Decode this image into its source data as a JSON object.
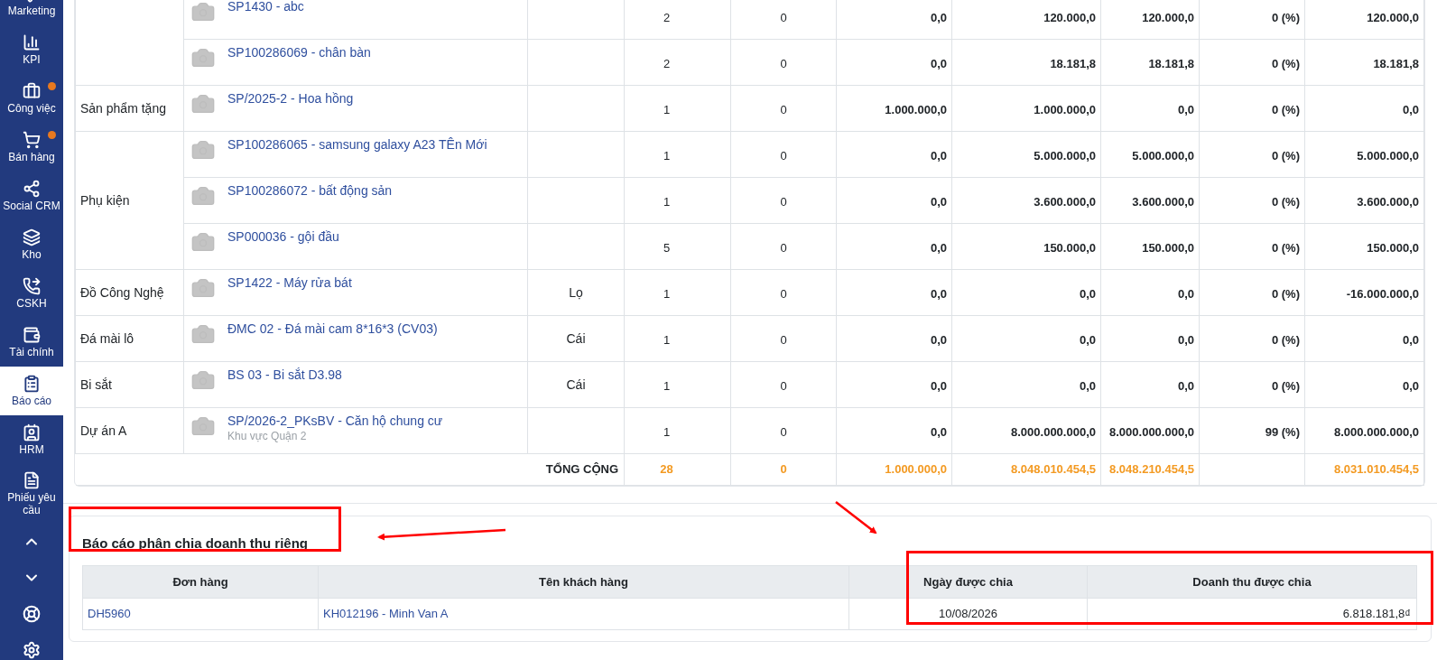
{
  "sidebar": {
    "items": [
      {
        "kind": "module",
        "label": "Marketing",
        "selected": false
      },
      {
        "kind": "module",
        "label": "KPI",
        "selected": false,
        "badge": false
      },
      {
        "kind": "module",
        "label": "Công việc",
        "selected": false,
        "badge": true
      },
      {
        "kind": "module",
        "label": "Bán hàng",
        "selected": false,
        "badge": true
      },
      {
        "kind": "module",
        "label": "Social CRM",
        "selected": false,
        "badge": false
      },
      {
        "kind": "module",
        "label": "Kho",
        "selected": false,
        "badge": false
      },
      {
        "kind": "module",
        "label": "CSKH",
        "selected": false,
        "badge": false
      },
      {
        "kind": "module",
        "label": "Tài chính",
        "selected": false,
        "badge": false
      },
      {
        "kind": "module",
        "label": "Báo cáo",
        "selected": true,
        "badge": false
      },
      {
        "kind": "module",
        "label": "HRM",
        "selected": false,
        "badge": false
      },
      {
        "kind": "module",
        "label": "Phiếu yêu cầu",
        "selected": false,
        "badge": false
      },
      {
        "kind": "icon",
        "selected": false
      },
      {
        "kind": "icon",
        "selected": false
      },
      {
        "kind": "icon",
        "selected": false
      },
      {
        "kind": "icon",
        "selected": false
      }
    ]
  },
  "sales_table": {
    "groups": [
      {
        "items": [
          {
            "product": "SP1430 - abc",
            "cells": [
              "2",
              "0",
              "0,0",
              "120.000,0",
              "120.000,0",
              "0 (%)",
              "120.000,0"
            ]
          },
          {
            "product": "SP100286069 - chân bàn",
            "cells": [
              "2",
              "0",
              "0,0",
              "18.181,8",
              "18.181,8",
              "0 (%)",
              "18.181,8"
            ]
          }
        ]
      },
      {
        "label": "Sản phẩm tặng",
        "items": [
          {
            "product": "SP/2025-2 - Hoa hồng",
            "cells": [
              "1",
              "0",
              "1.000.000,0",
              "1.000.000,0",
              "0,0",
              "0 (%)",
              "0,0"
            ]
          }
        ]
      },
      {
        "label": "Phụ kiện",
        "items": [
          {
            "product": "SP100286065 - samsung galaxy A23 TÊn Mới",
            "cells": [
              "1",
              "0",
              "0,0",
              "5.000.000,0",
              "5.000.000,0",
              "0 (%)",
              "5.000.000,0"
            ]
          },
          {
            "product": "SP100286072 - bất động sản",
            "cells": [
              "1",
              "0",
              "0,0",
              "3.600.000,0",
              "3.600.000,0",
              "0 (%)",
              "3.600.000,0"
            ]
          },
          {
            "product": "SP000036 - gội đầu",
            "cells": [
              "5",
              "0",
              "0,0",
              "150.000,0",
              "150.000,0",
              "0 (%)",
              "150.000,0"
            ]
          }
        ]
      },
      {
        "label": "Đồ Công Nghệ",
        "items": [
          {
            "product": "SP1422 - Máy rửa bát",
            "unit": "Lọ",
            "cells": [
              "1",
              "0",
              "0,0",
              "0,0",
              "0,0",
              "0 (%)",
              "-16.000.000,0"
            ]
          }
        ]
      },
      {
        "label": "Đá mài lô",
        "items": [
          {
            "product": "ĐMC 02 - Đá mài cam 8*16*3 (CV03)",
            "unit": "Cái",
            "cells": [
              "1",
              "0",
              "0,0",
              "0,0",
              "0,0",
              "0 (%)",
              "0,0"
            ]
          }
        ]
      },
      {
        "label": "Bi sắt",
        "items": [
          {
            "product": "BS 03 - Bi sắt D3.98",
            "unit": "Cái",
            "cells": [
              "1",
              "0",
              "0,0",
              "0,0",
              "0,0",
              "0 (%)",
              "0,0"
            ]
          }
        ]
      },
      {
        "label": "Dự án A",
        "items": [
          {
            "product": "SP/2026-2_PKsBV - Căn hộ chung cư",
            "subtitle": "Khu vực Quận 2",
            "cells": [
              "1",
              "0",
              "0,0",
              "8.000.000.000,0",
              "8.000.000.000,0",
              "99 (%)",
              "8.000.000.000,0"
            ]
          }
        ]
      }
    ],
    "total": {
      "label": "TỔNG CỘNG",
      "cells": [
        "28",
        "0",
        "1.000.000,0",
        "8.048.010.454,5",
        "8.048.210.454,5",
        null,
        "8.031.010.454,5"
      ]
    }
  },
  "split_report": {
    "title": "Báo cáo phân chia doanh thu riêng",
    "columns": [
      "Đơn hàng",
      "Tên khách hàng",
      "Ngày được chia",
      "Doanh thu được chia"
    ],
    "rows": [
      {
        "cells": [
          "DH5960",
          "KH012196 - Minh Van A",
          "10/08/2026",
          "6.818.181,8₫"
        ]
      }
    ]
  }
}
